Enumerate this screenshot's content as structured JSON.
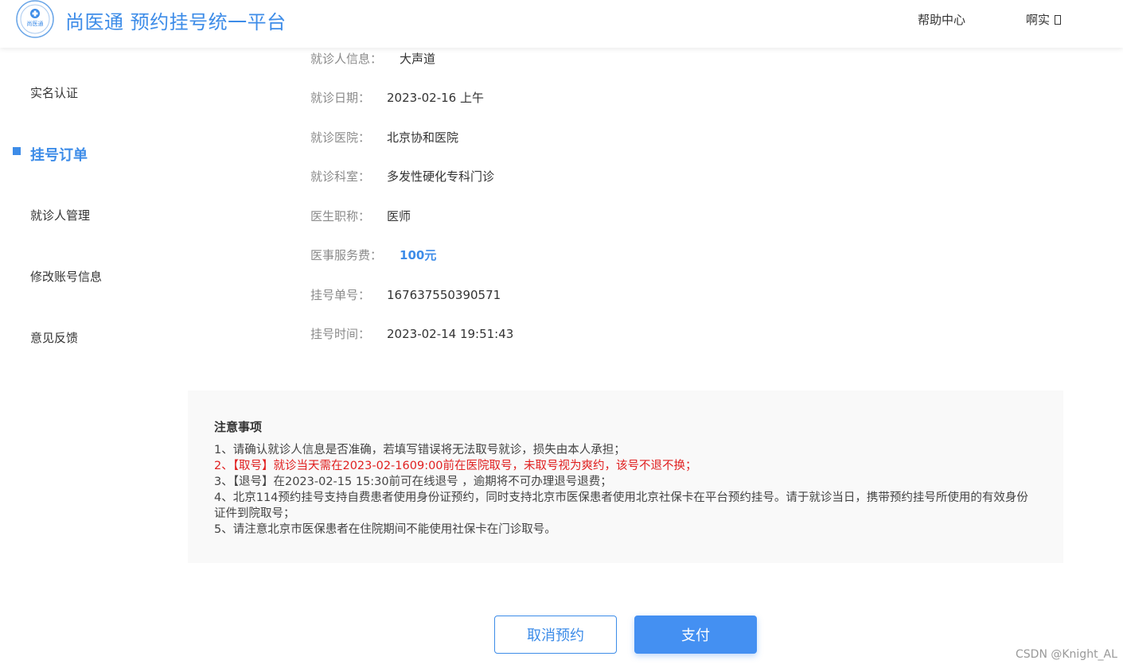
{
  "header": {
    "title": "尚医通 预约挂号统一平台",
    "logo_text": "尚医通",
    "help_label": "帮助中心",
    "user_label": "啊实"
  },
  "sidebar": {
    "items": [
      {
        "label": "实名认证",
        "active": false
      },
      {
        "label": "挂号订单",
        "active": true
      },
      {
        "label": "就诊人管理",
        "active": false
      },
      {
        "label": "修改账号信息",
        "active": false
      },
      {
        "label": "意见反馈",
        "active": false
      }
    ]
  },
  "order": {
    "rows": [
      {
        "label": "就诊人信息：",
        "value": "大声道"
      },
      {
        "label": "就诊日期：",
        "value": "2023-02-16 上午"
      },
      {
        "label": "就诊医院：",
        "value": "北京协和医院"
      },
      {
        "label": "就诊科室：",
        "value": "多发性硬化专科门诊"
      },
      {
        "label": "医生职称：",
        "value": "医师"
      },
      {
        "label": "医事服务费：",
        "value": "100元"
      },
      {
        "label": "挂号单号：",
        "value": "167637550390571"
      },
      {
        "label": "挂号时间：",
        "value": "2023-02-14 19:51:43"
      }
    ]
  },
  "notice": {
    "title": "注意事项",
    "lines": [
      "1、请确认就诊人信息是否准确，若填写错误将无法取号就诊，损失由本人承担；",
      "2、【取号】就诊当天需在2023-02-1609:00前在医院取号，未取号视为爽约，该号不退不换；",
      "3、【退号】在2023-02-15 15:30前可在线退号 ，逾期将不可办理退号退费；",
      "4、北京114预约挂号支持自费患者使用身份证预约，同时支持北京市医保患者使用北京社保卡在平台预约挂号。请于就诊当日，携带预约挂号所使用的有效身份证件到院取号；",
      "5、请注意北京市医保患者在住院期间不能使用社保卡在门诊取号。"
    ]
  },
  "actions": {
    "cancel_label": "取消预约",
    "pay_label": "支付"
  },
  "watermark": "CSDN @Knight_AL",
  "colors": {
    "accent": "#3d8ce8",
    "warning": "#e02020",
    "notice_bg": "#f9f9f9"
  }
}
